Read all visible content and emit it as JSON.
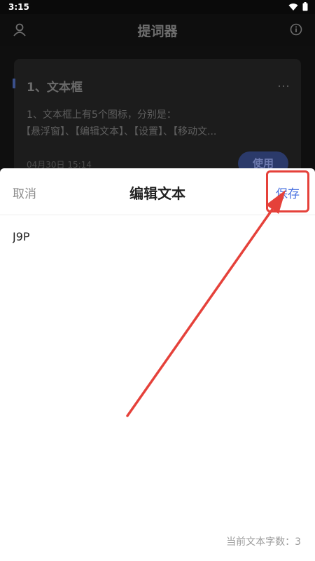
{
  "status_bar": {
    "time": "3:15",
    "icons": [
      "wifi-icon",
      "battery-icon"
    ]
  },
  "app_header": {
    "title": "提词器",
    "left_icon": "user-icon",
    "right_icon": "info-icon"
  },
  "background_card": {
    "title": "1、文本框",
    "body_line1": "1、文本框上有5个图标，分别是：",
    "body_line2": "【悬浮窗】、【编辑文本】、【设置】、【移动文...",
    "date": "04月30日 15:14",
    "use_button": "使用",
    "more_icon": "…"
  },
  "edit_sheet": {
    "cancel_label": "取消",
    "title": "编辑文本",
    "save_label": "保存",
    "text_value": "J9P",
    "char_count": "当前文本字数：3"
  },
  "colors": {
    "accent": "#4a72e0",
    "annotation": "#e5413a",
    "sheet_bg": "#ffffff",
    "dim_bg": "#141414"
  }
}
